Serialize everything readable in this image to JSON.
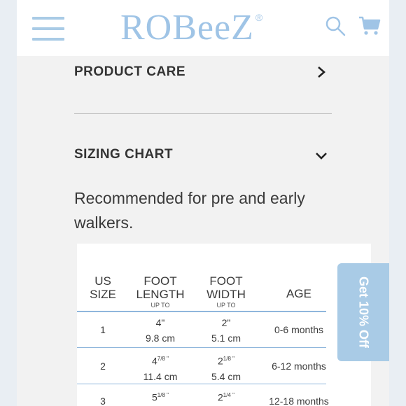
{
  "header": {
    "logo_text": "ROBeeZ",
    "logo_mark": "®",
    "menu_icon": "hamburger-icon",
    "search_icon": "search-icon",
    "cart_icon": "cart-icon",
    "brand_color": "#9fc4e6"
  },
  "sections": {
    "product_care": "PRODUCT CARE",
    "sizing_chart": "SIZING CHART"
  },
  "sizing": {
    "description": "Recommended for pre and early walkers.",
    "headers": {
      "us_size": [
        "US",
        "SIZE"
      ],
      "foot_length": [
        "FOOT",
        "LENGTH"
      ],
      "foot_length_sub": "UP TO",
      "foot_width": [
        "FOOT",
        "WIDTH"
      ],
      "foot_width_sub": "UP TO",
      "age": "AGE"
    },
    "rows": [
      {
        "size": "1",
        "length_in": "4\"",
        "length_cm": "9.8 cm",
        "width_in": "2\"",
        "width_cm": "5.1 cm",
        "age": "0-6 months"
      },
      {
        "size": "2",
        "length_in": "4",
        "length_frac": "7/8 \"",
        "length_cm": "11.4 cm",
        "width_in": "2",
        "width_frac": "1/8 \"",
        "width_cm": "5.4 cm",
        "age": "6-12 months"
      },
      {
        "size": "3",
        "length_in": "5",
        "length_frac": "1/8 \"",
        "width_in": "2",
        "width_frac": "1/4 \"",
        "age": "12-18 months"
      }
    ]
  },
  "promo": {
    "label": "Get 10% Off",
    "color": "#a9cbe6"
  }
}
